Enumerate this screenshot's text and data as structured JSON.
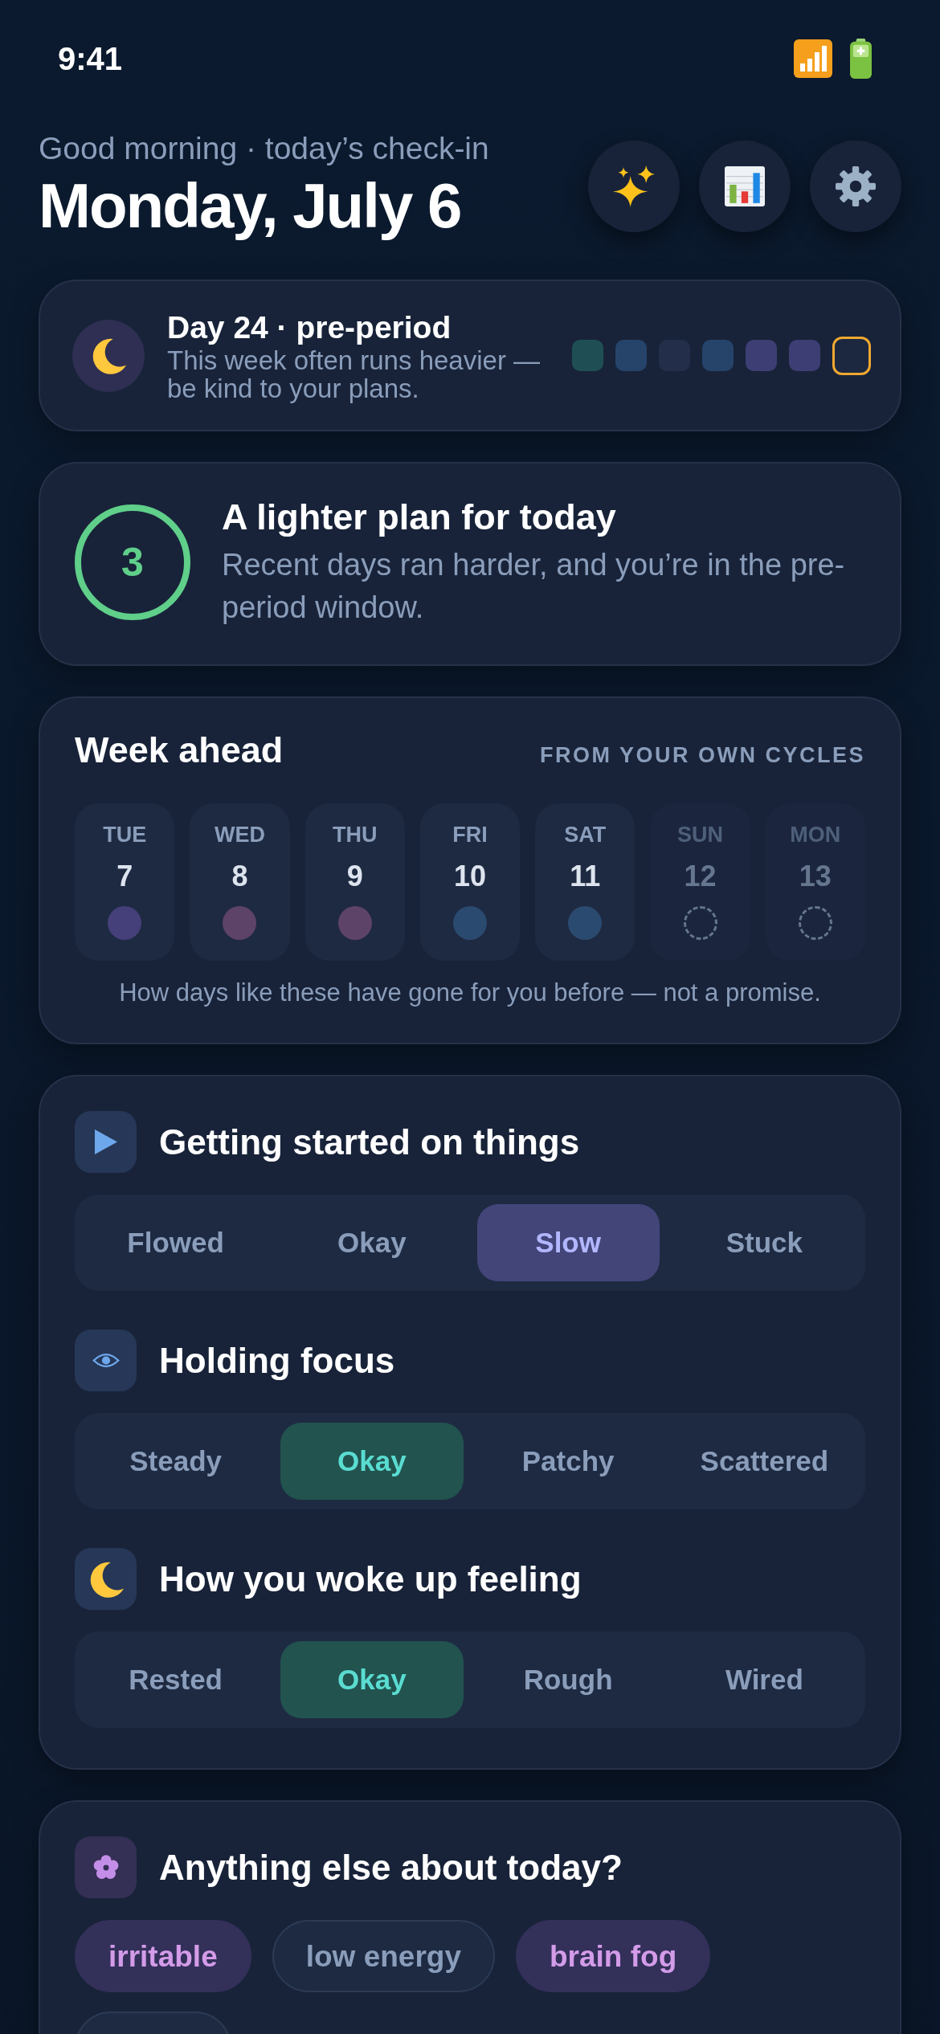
{
  "status_bar": {
    "time": "9:41"
  },
  "header": {
    "greeting": "Good morning · today’s check-in",
    "title": "Monday, July 6"
  },
  "cycle": {
    "title": "Day 24 · pre-period",
    "note": "This week often runs heavier — be kind to your plans.",
    "recent_days": [
      {
        "color": "#1f4f55",
        "current": false
      },
      {
        "color": "#26436a",
        "current": false
      },
      {
        "color": "#222e4a",
        "current": false
      },
      {
        "color": "#26436a",
        "current": false
      },
      {
        "color": "#3d3e73",
        "current": false
      },
      {
        "color": "#3d3e73",
        "current": false
      },
      {
        "color": "#1c2840",
        "current": true
      }
    ]
  },
  "plan": {
    "score": "3",
    "title": "A lighter plan for today",
    "description": "Recent days ran harder, and you’re in the pre-period window."
  },
  "week_ahead": {
    "title": "Week ahead",
    "source": "FROM YOUR OWN CYCLES",
    "days": [
      {
        "kind": "forecast",
        "day": "TUE",
        "date": "7",
        "color": "#453f7a"
      },
      {
        "kind": "forecast",
        "day": "WED",
        "date": "8",
        "color": "#5e4368"
      },
      {
        "kind": "forecast",
        "day": "THU",
        "date": "9",
        "color": "#5e4368"
      },
      {
        "kind": "forecast",
        "day": "FRI",
        "date": "10",
        "color": "#2b4a70"
      },
      {
        "kind": "forecast",
        "day": "SAT",
        "date": "11",
        "color": "#2b4a70"
      },
      {
        "kind": "unknown",
        "day": "SUN",
        "date": "12"
      },
      {
        "kind": "unknown",
        "day": "MON",
        "date": "13"
      }
    ],
    "footnote": "How days like these have gone for you before — not a promise."
  },
  "questions": [
    {
      "title": "Getting started on things",
      "color": "#434579",
      "options": [
        {
          "label": "Flowed",
          "selected": false
        },
        {
          "label": "Okay",
          "selected": false
        },
        {
          "label": "Slow",
          "selected": true
        },
        {
          "label": "Stuck",
          "selected": false
        }
      ]
    },
    {
      "title": "Holding focus",
      "color": "#22534f",
      "options": [
        {
          "label": "Steady",
          "selected": false
        },
        {
          "label": "Okay",
          "selected": true
        },
        {
          "label": "Patchy",
          "selected": false
        },
        {
          "label": "Scattered",
          "selected": false
        }
      ]
    },
    {
      "title": "How you woke up feeling",
      "color": "#22534f",
      "options": [
        {
          "label": "Rested",
          "selected": false
        },
        {
          "label": "Okay",
          "selected": true
        },
        {
          "label": "Rough",
          "selected": false
        },
        {
          "label": "Wired",
          "selected": false
        }
      ]
    }
  ],
  "extras": {
    "title": "Anything else about today?",
    "tags": [
      {
        "label": "irritable",
        "selected": true
      },
      {
        "label": "low energy",
        "selected": false
      },
      {
        "label": "brain fog",
        "selected": true
      },
      {
        "selected": false
      }
    ]
  }
}
